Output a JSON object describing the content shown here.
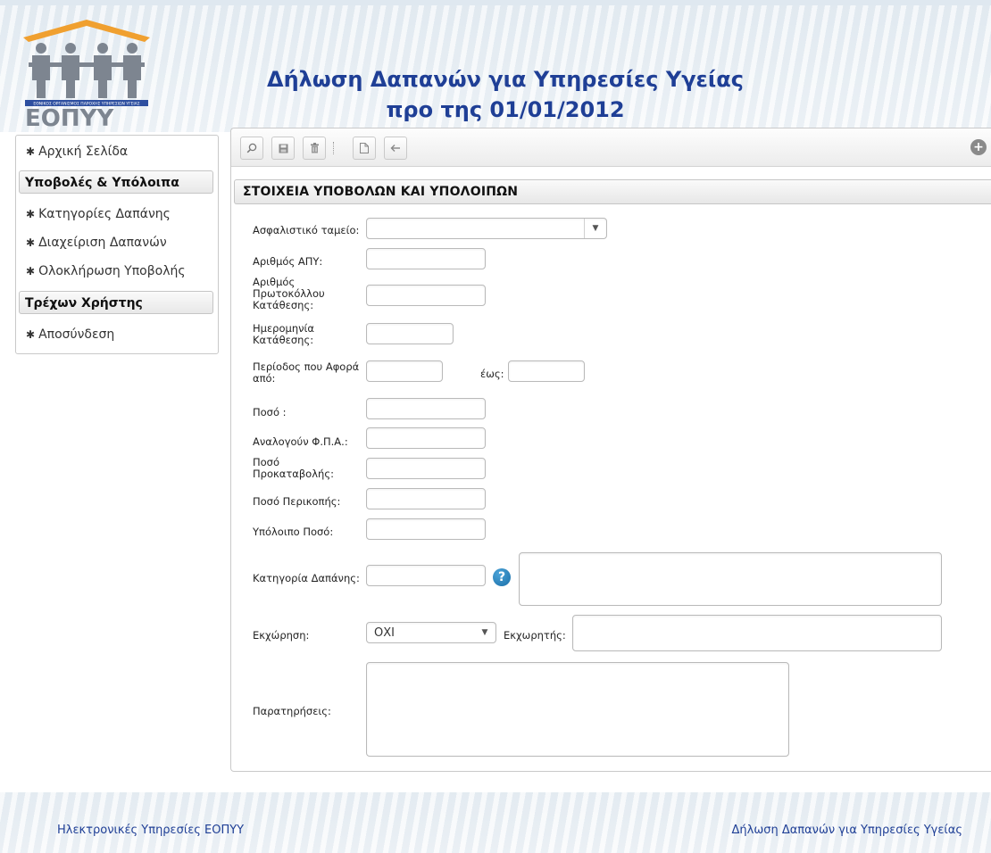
{
  "header": {
    "title_line1": "Δήλωση Δαπανών για Υπηρεσίες Υγείας",
    "title_line2": "προ της 01/01/2012",
    "logo_text": "ΕΟΠΥΥ",
    "logo_subtext": "ΕΘΝΙΚΟΣ ΟΡΓΑΝΙΣΜΟΣ ΠΑΡΟΧΗΣ ΥΠΗΡΕΣΙΩΝ ΥΓΕΙΑΣ"
  },
  "sidebar": {
    "home": "Αρχική Σελίδα",
    "section1": "Υποβολές & Υπόλοιπα",
    "item_categories": "Κατηγορίες Δαπάνης",
    "item_manage": "Διαχείριση Δαπανών",
    "item_complete": "Ολοκλήρωση Υποβολής",
    "section2": "Τρέχων Χρήστης",
    "item_logout": "Αποσύνδεση"
  },
  "toolbar": {
    "icons": [
      "search-icon",
      "save-icon",
      "delete-icon",
      "new-document-icon",
      "back-arrow-icon",
      "add-icon"
    ]
  },
  "form": {
    "section_title": "ΣΤΟΙΧΕΙΑ ΥΠΟΒΟΛΩΝ ΚΑΙ ΥΠΟΛΟΙΠΩΝ",
    "fund_label": "Ασφαλιστικό ταμείο:",
    "apy_label": "Αριθμός ΑΠΥ:",
    "protocol_label_1": "Αριθμός",
    "protocol_label_2": "Πρωτοκόλλου",
    "protocol_label_3": "Κατάθεσης:",
    "date_label_1": "Ημερομηνία",
    "date_label_2": "Κατάθεσης:",
    "period_label_1": "Περίοδος που Αφορά",
    "period_label_2": "από:",
    "period_to_label": "έως:",
    "amount_label": "Ποσό :",
    "vat_label": "Αναλογούν Φ.Π.Α.:",
    "advance_label_1": "Ποσό",
    "advance_label_2": "Προκαταβολής:",
    "cut_label": "Ποσό Περικοπής:",
    "remaining_label": "Υπόλοιπο Ποσό:",
    "category_label": "Κατηγορία Δαπάνης:",
    "assignment_label": "Εκχώρηση:",
    "assignment_value": "ΟΧΙ",
    "assignee_label": "Εκχωρητής:",
    "notes_label": "Παρατηρήσεις:"
  },
  "footer": {
    "left": "Ηλεκτρονικές Υπηρεσίες ΕΟΠΥΥ",
    "right": "Δήλωση Δαπανών για Υπηρεσίες Υγείας"
  },
  "colors": {
    "title": "#1f3f96",
    "logo_orange": "#f0a030",
    "logo_gray": "#7d8590"
  }
}
